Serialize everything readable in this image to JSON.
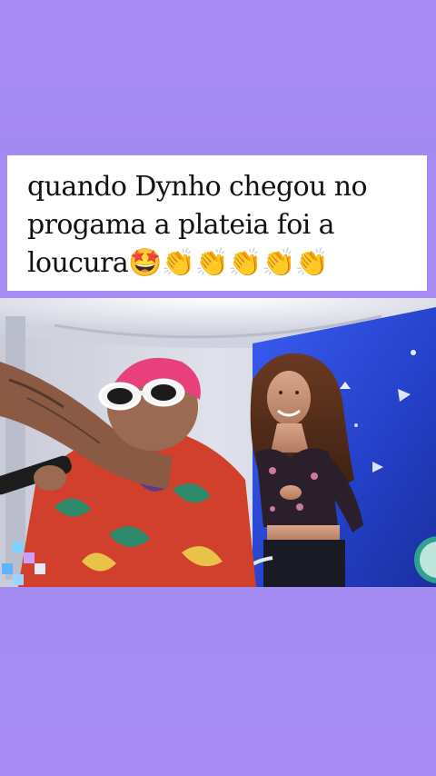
{
  "caption": {
    "text": "quando Dynho chegou no progama a plateia foi a loucura🤩👏👏👏👏👏"
  },
  "video": {
    "icon": "tv-show-video-frame",
    "colors": {
      "background_purple": "#a58bf2",
      "stage_blue": "#2f4fd8",
      "hair_pink": "#e8407a"
    }
  }
}
